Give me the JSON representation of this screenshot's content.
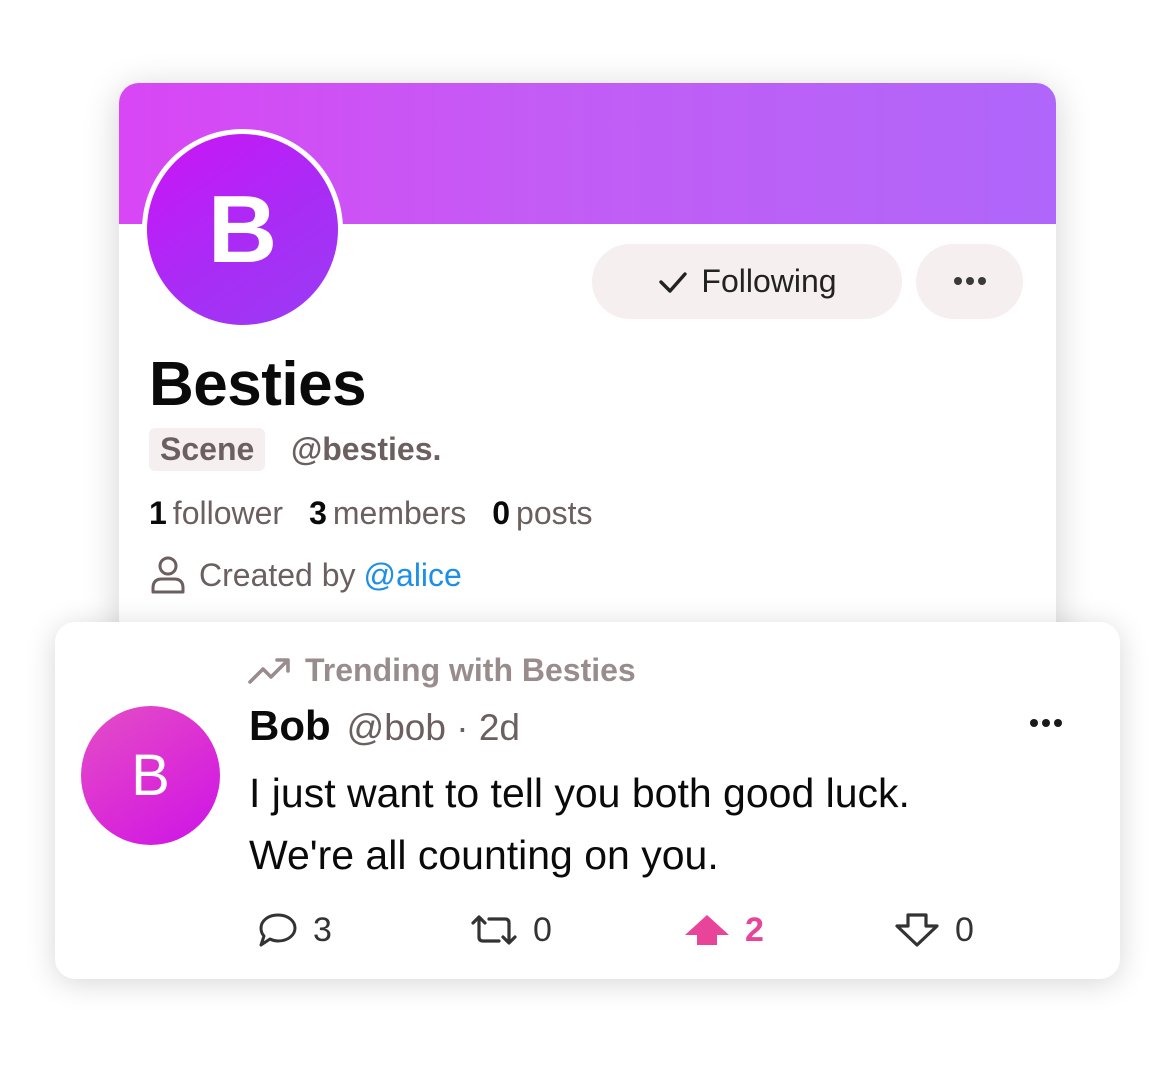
{
  "scene": {
    "avatar_letter": "B",
    "name": "Besties",
    "badge": "Scene",
    "handle": "@besties.",
    "following_label": "Following",
    "stats": [
      {
        "count": "1",
        "label": "follower"
      },
      {
        "count": "3",
        "label": "members"
      },
      {
        "count": "0",
        "label": "posts"
      }
    ],
    "created_by_label": "Created by",
    "creator_handle": "@alice"
  },
  "post": {
    "trending_label": "Trending with Besties",
    "avatar_letter": "B",
    "author_name": "Bob",
    "author_meta": "@bob · 2d",
    "text_line1": "I just want to tell you both good luck.",
    "text_line2": "We're all counting on you.",
    "actions": {
      "replies": "3",
      "reposts": "0",
      "upvotes": "2",
      "downvotes": "0"
    }
  },
  "colors": {
    "banner_start": "#d946f5",
    "banner_end": "#b066fa",
    "link": "#1d8fe8",
    "upvote_active": "#e8449a",
    "muted_text": "#6b5f5f"
  },
  "icons": [
    "check-icon",
    "more-icon",
    "person-icon",
    "trending-icon",
    "reply-icon",
    "repost-icon",
    "upvote-icon",
    "downvote-icon"
  ]
}
